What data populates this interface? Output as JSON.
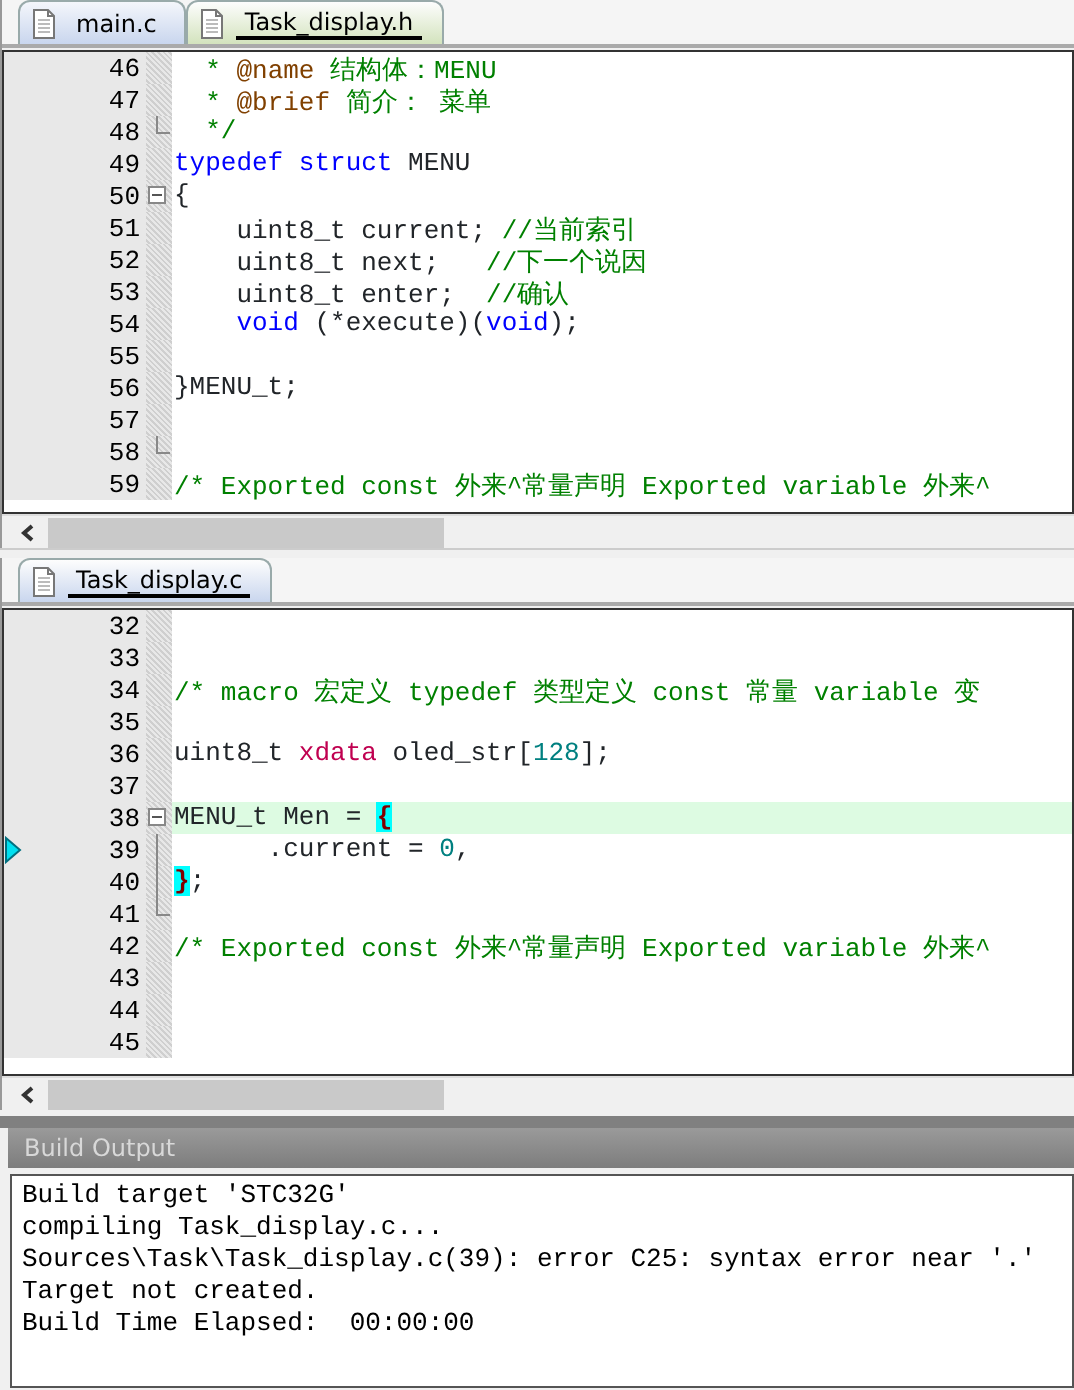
{
  "editors": [
    {
      "tabs": [
        {
          "label": "main.c",
          "selected": false,
          "color": "#c9d6ee"
        },
        {
          "label": "Task_display.h",
          "selected": true,
          "color": "#d3e3bd"
        }
      ],
      "lines": [
        {
          "number": "46",
          "kind": "plain",
          "highlighted": false,
          "arrow": false,
          "tokens": [
            {
              "kind": "comment",
              "text": "  * "
            },
            {
              "kind": "doctag",
              "text": "@name"
            },
            {
              "kind": "comment",
              "text": " 结构体：MENU"
            }
          ]
        },
        {
          "number": "47",
          "kind": "plain",
          "highlighted": false,
          "arrow": false,
          "tokens": [
            {
              "kind": "comment",
              "text": "  * "
            },
            {
              "kind": "doctag",
              "text": "@brief"
            },
            {
              "kind": "comment",
              "text": " 简介： 菜单"
            }
          ]
        },
        {
          "number": "48",
          "kind": "fold_end",
          "highlighted": false,
          "arrow": false,
          "tokens": [
            {
              "kind": "comment",
              "text": "  */"
            }
          ]
        },
        {
          "number": "49",
          "kind": "plain",
          "highlighted": false,
          "arrow": false,
          "tokens": [
            {
              "kind": "keyword",
              "text": "typedef struct"
            },
            {
              "kind": "plain",
              "text": " MENU"
            }
          ]
        },
        {
          "number": "50",
          "kind": "fold_start",
          "highlighted": false,
          "arrow": false,
          "tokens": [
            {
              "kind": "plain",
              "text": "{"
            }
          ]
        },
        {
          "number": "51",
          "kind": "plain",
          "highlighted": false,
          "arrow": false,
          "tokens": [
            {
              "kind": "plain",
              "text": "    uint8_t current; "
            },
            {
              "kind": "comment",
              "text": "//当前索引"
            }
          ]
        },
        {
          "number": "52",
          "kind": "plain",
          "highlighted": false,
          "arrow": false,
          "tokens": [
            {
              "kind": "plain",
              "text": "    uint8_t next;   "
            },
            {
              "kind": "comment",
              "text": "//下一个说因"
            }
          ]
        },
        {
          "number": "53",
          "kind": "plain",
          "highlighted": false,
          "arrow": false,
          "tokens": [
            {
              "kind": "plain",
              "text": "    uint8_t enter;  "
            },
            {
              "kind": "comment",
              "text": "//确认"
            }
          ]
        },
        {
          "number": "54",
          "kind": "plain",
          "highlighted": false,
          "arrow": false,
          "tokens": [
            {
              "kind": "keyword",
              "text": "    void"
            },
            {
              "kind": "plain",
              "text": " (*execute)("
            },
            {
              "kind": "keyword",
              "text": "void"
            },
            {
              "kind": "plain",
              "text": ");"
            }
          ]
        },
        {
          "number": "55",
          "kind": "plain",
          "highlighted": false,
          "arrow": false
        },
        {
          "number": "56",
          "kind": "plain",
          "highlighted": false,
          "arrow": false,
          "tokens": [
            {
              "kind": "plain",
              "text": "}MENU_t;"
            }
          ]
        },
        {
          "number": "57",
          "kind": "plain",
          "highlighted": false,
          "arrow": false
        },
        {
          "number": "58",
          "kind": "fold_end",
          "highlighted": false,
          "arrow": false
        },
        {
          "number": "59",
          "kind": "plain",
          "highlighted": false,
          "arrow": false,
          "tokens": [
            {
              "kind": "comment",
              "text": "/* Exported const 外来^常量声明 Exported variable 外来^"
            }
          ]
        }
      ]
    },
    {
      "tabs": [
        {
          "label": "Task_display.c",
          "selected": true,
          "color": "#c9d6ee"
        }
      ],
      "lines": [
        {
          "number": "32",
          "kind": "plain",
          "highlighted": false,
          "arrow": false
        },
        {
          "number": "33",
          "kind": "plain",
          "highlighted": false,
          "arrow": false
        },
        {
          "number": "34",
          "kind": "plain",
          "highlighted": false,
          "arrow": false,
          "tokens": [
            {
              "kind": "comment",
              "text": "/* macro 宏定义 typedef 类型定义 const 常量 variable 变"
            }
          ]
        },
        {
          "number": "35",
          "kind": "plain",
          "highlighted": false,
          "arrow": false
        },
        {
          "number": "36",
          "kind": "plain",
          "highlighted": false,
          "arrow": false,
          "tokens": [
            {
              "kind": "plain",
              "text": "uint8_t "
            },
            {
              "kind": "storage",
              "text": "xdata"
            },
            {
              "kind": "plain",
              "text": " oled_str["
            },
            {
              "kind": "number",
              "text": "128"
            },
            {
              "kind": "plain",
              "text": "];"
            }
          ]
        },
        {
          "number": "37",
          "kind": "plain",
          "highlighted": false,
          "arrow": false
        },
        {
          "number": "38",
          "kind": "fold_start",
          "highlighted": true,
          "arrow": false,
          "tokens": [
            {
              "kind": "plain",
              "text": "MENU_t Men = "
            },
            {
              "kind": "brace",
              "text": "{"
            }
          ]
        },
        {
          "number": "39",
          "kind": "fold_inner",
          "highlighted": false,
          "arrow": true,
          "tokens": [
            {
              "kind": "plain",
              "text": "      .current = "
            },
            {
              "kind": "number",
              "text": "0"
            },
            {
              "kind": "plain",
              "text": ","
            }
          ]
        },
        {
          "number": "40",
          "kind": "fold_inner",
          "highlighted": false,
          "arrow": false,
          "tokens": [
            {
              "kind": "brace",
              "text": "}"
            },
            {
              "kind": "plain",
              "text": ";"
            }
          ]
        },
        {
          "number": "41",
          "kind": "fold_end",
          "highlighted": false,
          "arrow": false
        },
        {
          "number": "42",
          "kind": "plain",
          "highlighted": false,
          "arrow": false,
          "tokens": [
            {
              "kind": "comment",
              "text": "/* Exported const 外来^常量声明 Exported variable 外来^"
            }
          ]
        },
        {
          "number": "43",
          "kind": "plain",
          "highlighted": false,
          "arrow": false
        },
        {
          "number": "44",
          "kind": "plain",
          "highlighted": false,
          "arrow": false
        },
        {
          "number": "45",
          "kind": "plain",
          "highlighted": false,
          "arrow": false
        }
      ]
    }
  ],
  "build_output": {
    "title": "Build Output",
    "lines": [
      "Build target 'STC32G'",
      "compiling Task_display.c...",
      "Sources\\Task\\Task_display.c(39): error C25: syntax error near '.'",
      "Target not created.",
      "Build Time Elapsed:  00:00:00"
    ]
  }
}
